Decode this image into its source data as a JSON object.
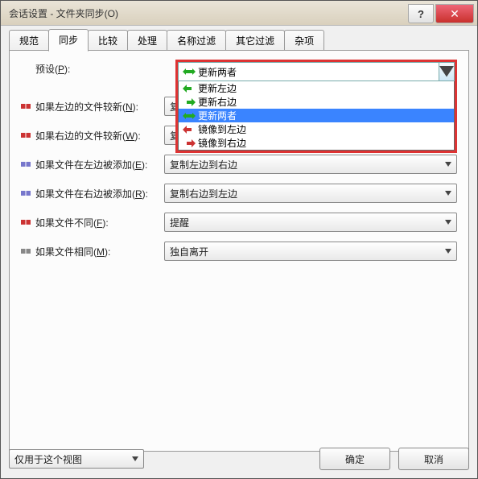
{
  "window": {
    "title": "会话设置 - 文件夹同步(O)"
  },
  "tabs": [
    "规范",
    "同步",
    "比较",
    "处理",
    "名称过滤",
    "其它过滤",
    "杂项"
  ],
  "active_tab": 1,
  "rows": {
    "preset": {
      "label_pre": "预设(",
      "key": "P",
      "label_post": "):"
    },
    "newer_left": {
      "label_pre": "如果左边的文件较新(",
      "key": "N",
      "label_post": "):",
      "value": "复制左边到右边"
    },
    "newer_right": {
      "label_pre": "如果右边的文件较新(",
      "key": "W",
      "label_post": "):",
      "value": "复制右边到左边"
    },
    "added_left": {
      "label_pre": "如果文件在左边被添加(",
      "key": "E",
      "label_post": "):",
      "value": "复制左边到右边"
    },
    "added_right": {
      "label_pre": "如果文件在右边被添加(",
      "key": "R",
      "label_post": "):",
      "value": "复制右边到左边"
    },
    "diff": {
      "label_pre": "如果文件不同(",
      "key": "F",
      "label_post": "):",
      "value": "提醒"
    },
    "same": {
      "label_pre": "如果文件相同(",
      "key": "M",
      "label_post": "):",
      "value": "独自离开"
    }
  },
  "preset_dropdown": {
    "selected": "更新两者",
    "options": [
      "更新左边",
      "更新右边",
      "更新两者",
      "镜像到左边",
      "镜像到右边"
    ],
    "highlighted": 2
  },
  "footer": {
    "scope": "仅用于这个视图",
    "ok": "确定",
    "cancel": "取消"
  }
}
